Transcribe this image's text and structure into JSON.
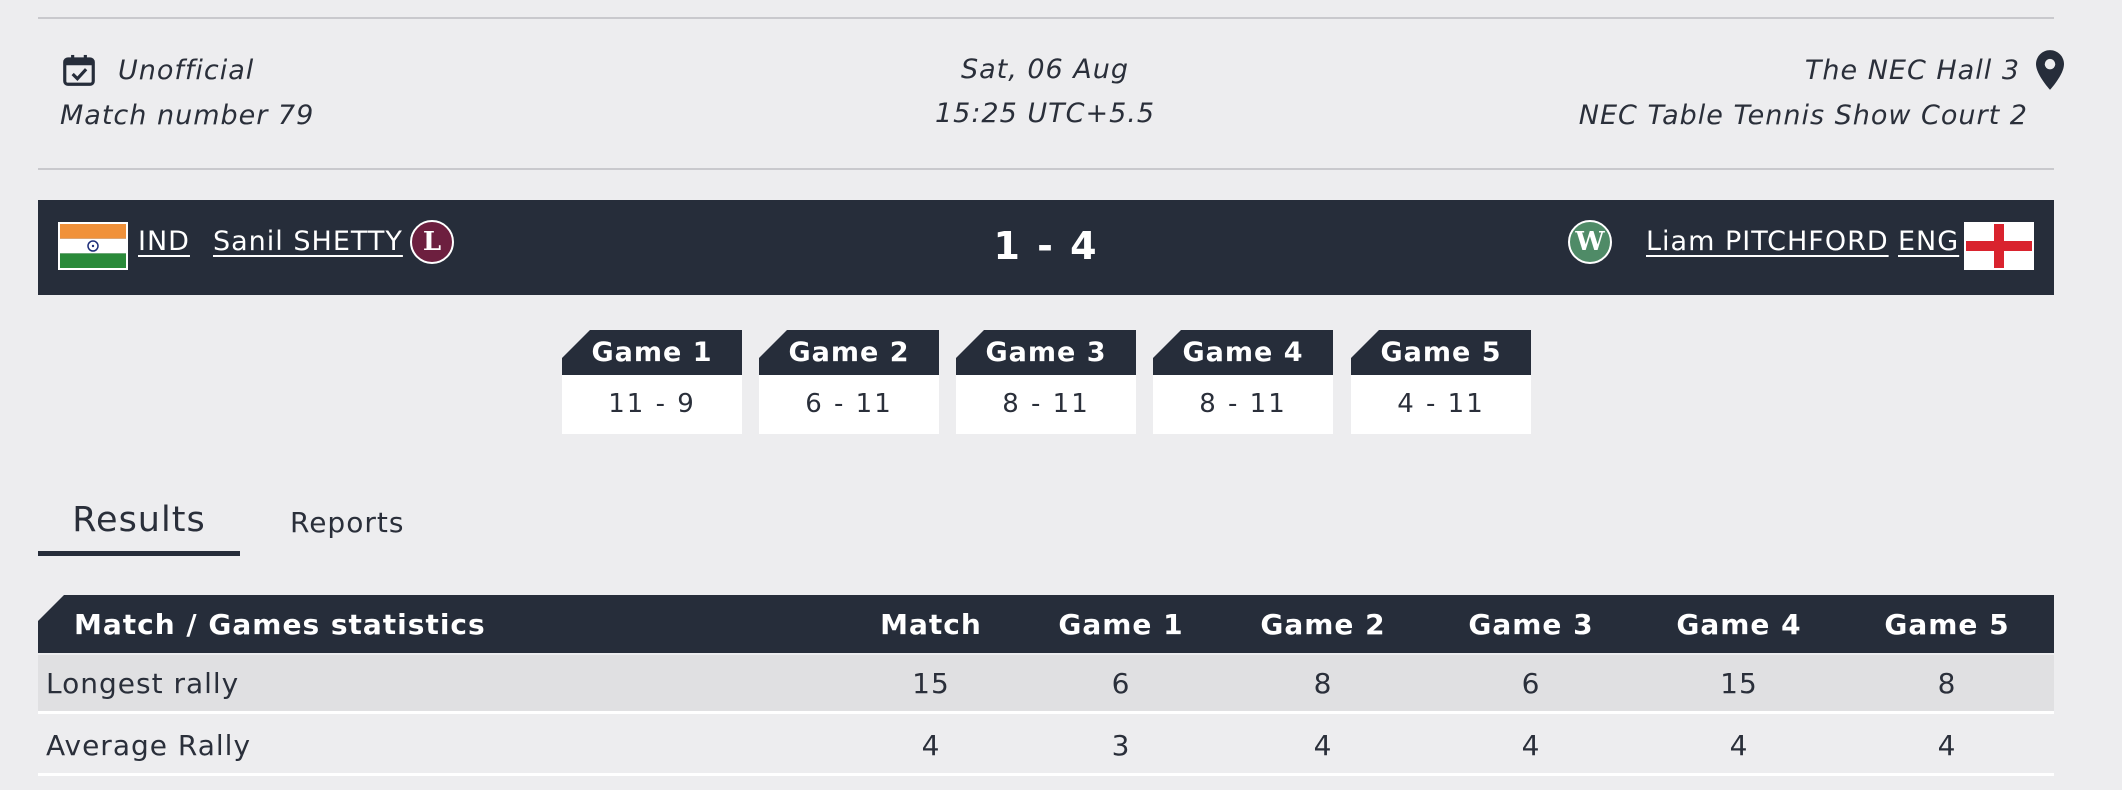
{
  "match_info": {
    "status": "Unofficial",
    "match_number": "Match number 79",
    "date": "Sat, 06 Aug",
    "time": "15:25 UTC+5.5",
    "venue": "The NEC Hall 3",
    "court": "NEC Table Tennis Show Court 2"
  },
  "score": {
    "left": {
      "country": "IND",
      "player": "Sanil SHETTY",
      "result_badge": "L"
    },
    "right": {
      "country": "ENG",
      "player": "Liam PITCHFORD",
      "result_badge": "W"
    },
    "match_score": "1 - 4"
  },
  "games": [
    {
      "label": "Game 1",
      "score": "11 - 9"
    },
    {
      "label": "Game 2",
      "score": "6 - 11"
    },
    {
      "label": "Game 3",
      "score": "8 - 11"
    },
    {
      "label": "Game 4",
      "score": "8 - 11"
    },
    {
      "label": "Game 5",
      "score": "4 - 11"
    }
  ],
  "tabs": {
    "results": "Results",
    "reports": "Reports"
  },
  "stats": {
    "headers": [
      "Match / Games statistics",
      "Match",
      "Game 1",
      "Game 2",
      "Game 3",
      "Game 4",
      "Game 5"
    ],
    "rows": [
      {
        "label": "Longest rally",
        "values": [
          "15",
          "6",
          "8",
          "6",
          "15",
          "8"
        ]
      },
      {
        "label": "Average Rally",
        "values": [
          "4",
          "3",
          "4",
          "4",
          "4",
          "4"
        ]
      }
    ]
  },
  "colors": {
    "dark_navy": "#262d3a",
    "loss_badge": "#6d1f3f",
    "win_badge": "#4f8b67",
    "background": "#ededef"
  },
  "icons": {
    "status": "calendar-check-icon",
    "venue": "map-pin-icon"
  }
}
